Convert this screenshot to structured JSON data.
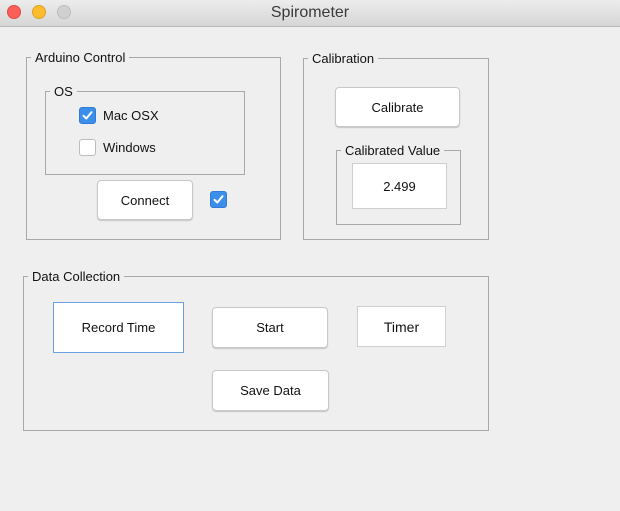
{
  "window": {
    "title": "Spirometer"
  },
  "arduino": {
    "legend": "Arduino Control",
    "os": {
      "legend": "OS",
      "mac_label": "Mac OSX",
      "mac_checked": true,
      "windows_label": "Windows",
      "windows_checked": false
    },
    "connect_label": "Connect",
    "connected_checked": true
  },
  "calibration": {
    "legend": "Calibration",
    "calibrate_label": "Calibrate",
    "value_legend": "Calibrated Value",
    "value": "2.499"
  },
  "data_collection": {
    "legend": "Data Collection",
    "record_time_label": "Record Time",
    "start_label": "Start",
    "timer_label": "Timer",
    "save_label": "Save Data"
  },
  "colors": {
    "accent": "#3b8eea",
    "close": "#fc5f57",
    "minimize": "#fdbc2e"
  },
  "icons": [
    "close-icon",
    "minimize-icon",
    "zoom-icon",
    "checkmark-icon"
  ]
}
